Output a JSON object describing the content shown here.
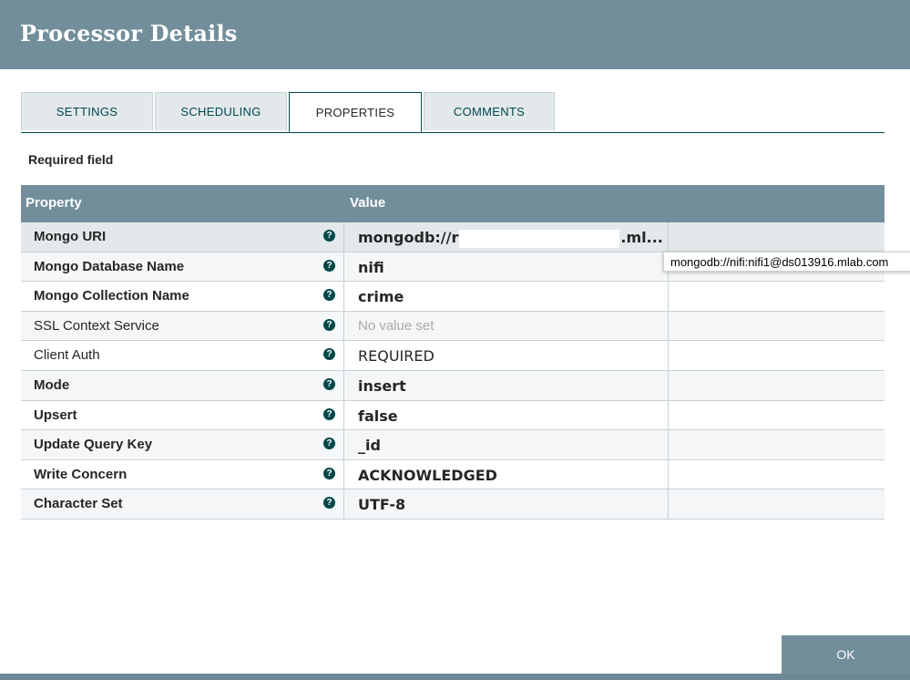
{
  "dialog": {
    "title": "Processor Details",
    "required_label": "Required field",
    "ok_label": "OK"
  },
  "tabs": [
    {
      "label": "SETTINGS"
    },
    {
      "label": "SCHEDULING"
    },
    {
      "label": "PROPERTIES"
    },
    {
      "label": "COMMENTS"
    }
  ],
  "grid": {
    "columns": {
      "property": "Property",
      "value": "Value"
    },
    "rows": [
      {
        "name": "Mongo URI",
        "value_prefix": "mongodb://r",
        "value_suffix": ".ml..."
      },
      {
        "name": "Mongo Database Name",
        "value": "nifi"
      },
      {
        "name": "Mongo Collection Name",
        "value": "crime"
      },
      {
        "name": "SSL Context Service",
        "value": "No value set"
      },
      {
        "name": "Client Auth",
        "value": "REQUIRED"
      },
      {
        "name": "Mode",
        "value": "insert"
      },
      {
        "name": "Upsert",
        "value": "false"
      },
      {
        "name": "Update Query Key",
        "value": "_id"
      },
      {
        "name": "Write Concern",
        "value": "ACKNOWLEDGED"
      },
      {
        "name": "Character Set",
        "value": "UTF-8"
      }
    ]
  },
  "tooltip": {
    "text": "mongodb://nifi:nifi1@ds013916.mlab.com"
  },
  "icons": {
    "help": "?"
  }
}
